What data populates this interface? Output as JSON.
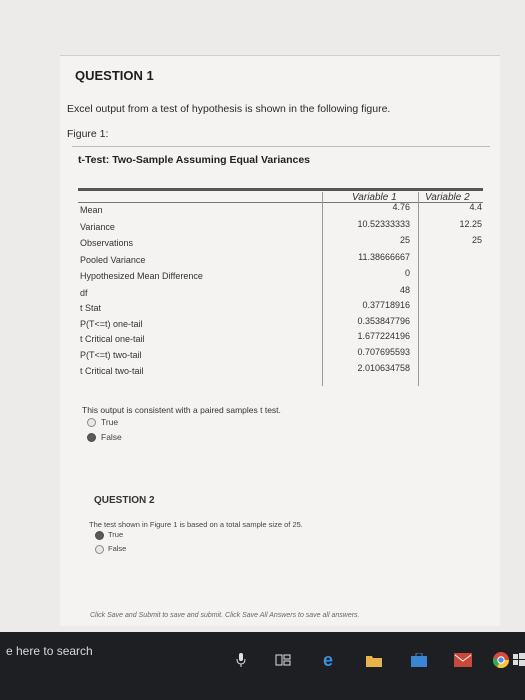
{
  "question1": {
    "title": "QUESTION 1",
    "text": "Excel output from a test of hypothesis is shown in the following figure.",
    "figure_label": "Figure 1:",
    "table_title": "t-Test: Two-Sample Assuming Equal Variances",
    "headers": [
      "Variable 1",
      "Variable 2"
    ],
    "rows": [
      {
        "label": "Mean",
        "v1": "4.76",
        "v2": "4.4"
      },
      {
        "label": "Variance",
        "v1": "10.52333333",
        "v2": "12.25"
      },
      {
        "label": "Observations",
        "v1": "25",
        "v2": "25"
      },
      {
        "label": "Pooled Variance",
        "v1": "11.38666667",
        "v2": ""
      },
      {
        "label": "Hypothesized Mean Difference",
        "v1": "0",
        "v2": ""
      },
      {
        "label": "df",
        "v1": "48",
        "v2": ""
      },
      {
        "label": "t Stat",
        "v1": "0.37718916",
        "v2": ""
      },
      {
        "label": "P(T<=t) one-tail",
        "v1": "0.353847796",
        "v2": ""
      },
      {
        "label": "t Critical one-tail",
        "v1": "1.677224196",
        "v2": ""
      },
      {
        "label": "P(T<=t) two-tail",
        "v1": "0.707695593",
        "v2": ""
      },
      {
        "label": "t Critical two-tail",
        "v1": "2.010634758",
        "v2": ""
      }
    ],
    "prompt": "This output is consistent with a paired samples t test.",
    "options": [
      {
        "label": "True",
        "selected": false
      },
      {
        "label": "False",
        "selected": true
      }
    ]
  },
  "question2": {
    "title": "QUESTION 2",
    "text": "The test shown in Figure 1 is based on a total sample size of 25.",
    "options": [
      {
        "label": "True",
        "selected": true
      },
      {
        "label": "False",
        "selected": false
      }
    ]
  },
  "footer_note": "Click Save and Submit to save and submit. Click Save All Answers to save all answers.",
  "taskbar": {
    "search_text": "e here to search",
    "icons": [
      "microphone-icon",
      "task-view-icon",
      "edge-icon",
      "file-explorer-icon",
      "store-icon",
      "mail-icon",
      "chrome-icon",
      "windows-logo-icon"
    ]
  },
  "colors": {
    "selected_radio": "#5a5a5a",
    "taskbar": "#1e1f22"
  }
}
